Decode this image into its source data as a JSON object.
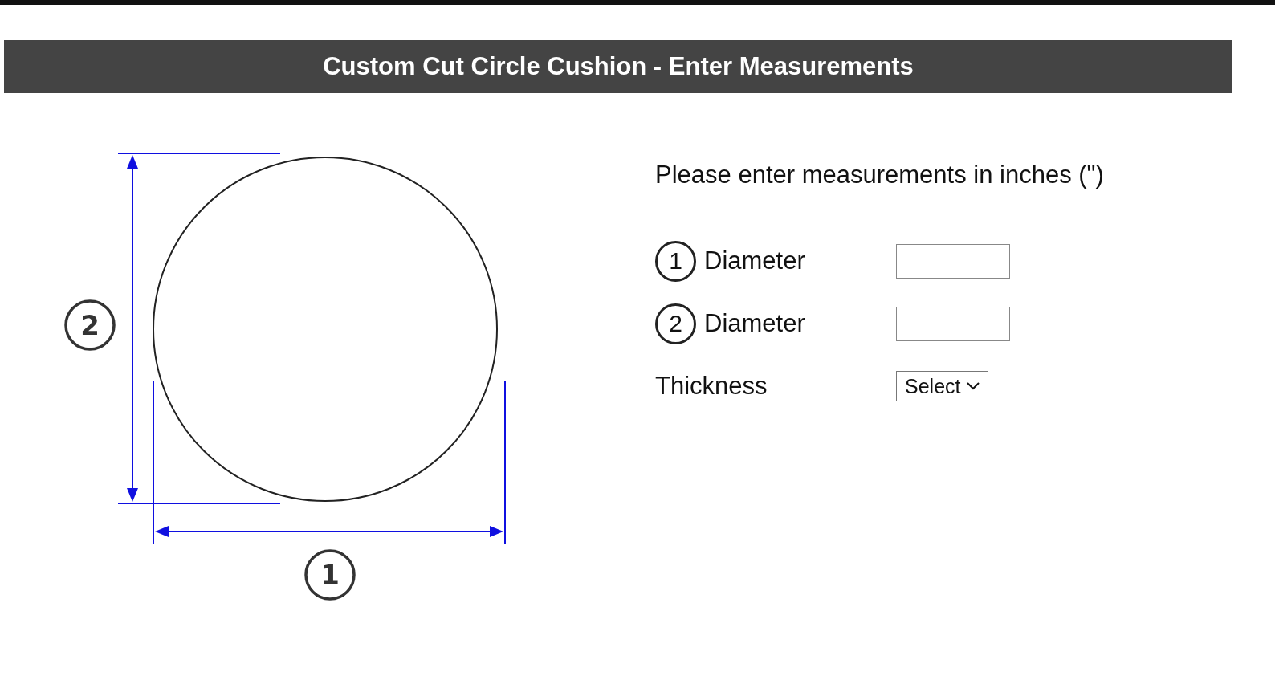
{
  "header": {
    "title": "Custom Cut Circle Cushion - Enter Measurements"
  },
  "diagram": {
    "height_label": "2",
    "width_label": "1"
  },
  "instruction": "Please enter measurements in inches (\")",
  "fields": [
    {
      "kind": "text",
      "number": "1",
      "label": "Diameter"
    },
    {
      "kind": "text",
      "number": "2",
      "label": "Diameter"
    },
    {
      "kind": "select",
      "label": "Thickness",
      "value": "Select"
    }
  ]
}
